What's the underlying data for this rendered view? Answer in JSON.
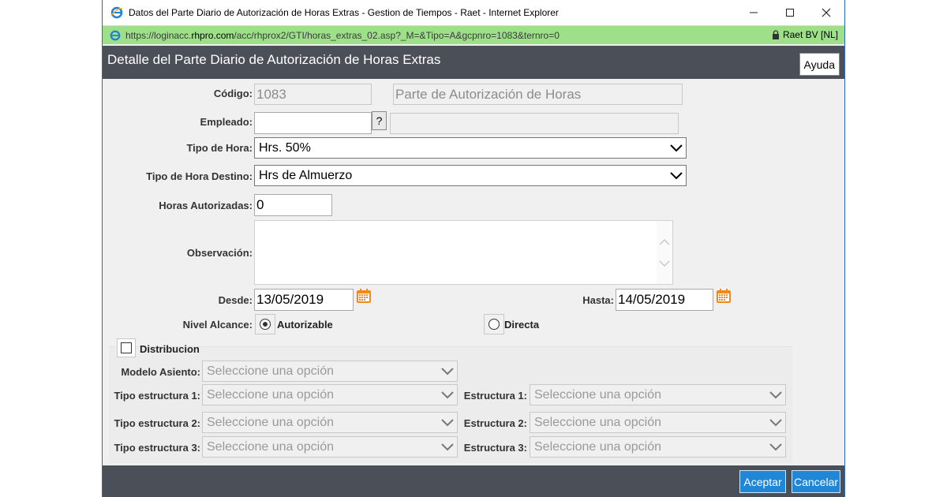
{
  "window": {
    "title": "Datos del Parte Diario de Autorización de Horas Extras - Gestion de Tiempos - Raet - Internet Explorer",
    "url_prefix": "https://loginacc.",
    "url_host": "rhpro.com",
    "url_path": "/acc/rhprox2/GTI/horas_extras_02.asp?_M=&Tipo=A&gcpnro=1083&ternro=0",
    "certificate": "Raet BV [NL]"
  },
  "header": {
    "title": "Detalle del Parte Diario de Autorización de Horas Extras",
    "help_label": "Ayuda"
  },
  "form": {
    "codigo_label": "Código:",
    "codigo_value": "1083",
    "codigo_desc": "Parte de Autorización de Horas",
    "empleado_label": "Empleado:",
    "empleado_value": "",
    "empleado_help": "?",
    "empleado_name": "",
    "tipo_hora_label": "Tipo de Hora:",
    "tipo_hora_value": "Hrs. 50%",
    "tipo_hora_destino_label": "Tipo de Hora Destino:",
    "tipo_hora_destino_value": "Hrs de Almuerzo",
    "horas_autorizadas_label": "Horas Autorizadas:",
    "horas_autorizadas_value": "0",
    "observacion_label": "Observación:",
    "observacion_value": "",
    "desde_label": "Desde:",
    "desde_value": "13/05/2019",
    "hasta_label": "Hasta:",
    "hasta_value": "14/05/2019",
    "nivel_alcance_label": "Nivel Alcance:",
    "nivel_alcance_options": [
      "Autorizable",
      "Directa"
    ],
    "nivel_alcance_selected": "Autorizable"
  },
  "distribucion": {
    "label": "Distribucion",
    "checked": false,
    "modelo_asiento_label": "Modelo Asiento:",
    "tipo_estructura_1_label": "Tipo estructura 1:",
    "tipo_estructura_2_label": "Tipo estructura 2:",
    "tipo_estructura_3_label": "Tipo estructura 3:",
    "estructura_1_label": "Estructura 1:",
    "estructura_2_label": "Estructura 2:",
    "estructura_3_label": "Estructura 3:",
    "placeholder": "Seleccione una opción"
  },
  "footer": {
    "accept_label": "Aceptar",
    "cancel_label": "Cancelar"
  },
  "colors": {
    "header_bg": "#4b4f58",
    "address_bar_bg": "#9ee08a",
    "button_blue": "#1f87d6",
    "calendar_orange": "#f08a1c"
  }
}
